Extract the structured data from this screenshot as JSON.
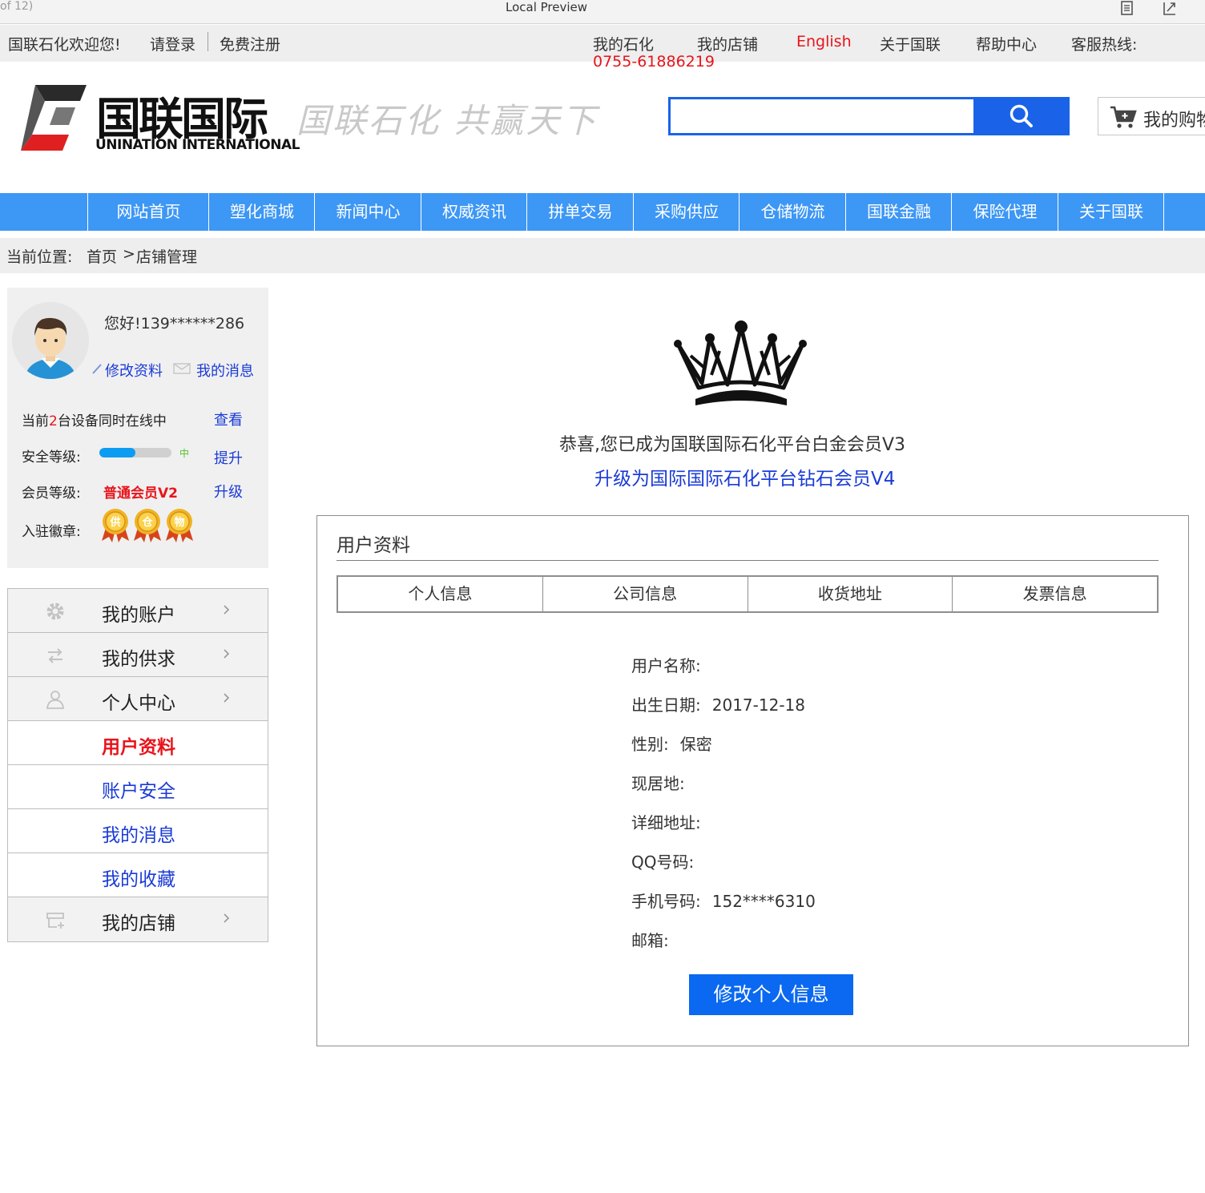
{
  "preview": {
    "page_info": "of 12)",
    "title": "Local Preview"
  },
  "topbar": {
    "welcome": "国联石化欢迎您!",
    "login": "请登录",
    "register": "免费注册",
    "my_petro": "我的石化",
    "my_shop": "我的店铺",
    "english": "English",
    "about": "关于国联",
    "help": "帮助中心",
    "hotline_label": "客服热线:",
    "hotline_number": "0755-61886219"
  },
  "header": {
    "logo_cn": "国联国际",
    "logo_en": "UNINATION INTERNATIONAL",
    "slogan": "国联石化 共赢天下",
    "search_value": "",
    "cart_label": "我的购物车"
  },
  "nav": [
    "网站首页",
    "塑化商城",
    "新闻中心",
    "权威资讯",
    "拼单交易",
    "采购供应",
    "仓储物流",
    "国联金融",
    "保险代理",
    "关于国联"
  ],
  "breadcrumb": {
    "label": "当前位置:",
    "home": "首页",
    "sep": ">",
    "current": "店铺管理"
  },
  "profile": {
    "greeting": "您好!139******286",
    "edit_profile": "修改资料",
    "my_messages": "我的消息",
    "devices_prefix": "当前",
    "devices_count": "2",
    "devices_suffix": "台设备同时在线中",
    "view": "查看",
    "security_label": "安全等级:",
    "security_level_text": "中",
    "security_level": 0.5,
    "improve": "提升",
    "member_label": "会员等级:",
    "member_level": "普通会员V2",
    "upgrade": "升级",
    "badges_label": "入驻徽章:",
    "badges": [
      "供",
      "仓",
      "物"
    ]
  },
  "menu": [
    {
      "label": "我的账户",
      "type": "group",
      "icon": "gear-icon"
    },
    {
      "label": "我的供求",
      "type": "group",
      "icon": "exchange-icon"
    },
    {
      "label": "个人中心",
      "type": "group",
      "icon": "user-icon"
    },
    {
      "label": "用户资料",
      "type": "active"
    },
    {
      "label": "账户安全",
      "type": "sub"
    },
    {
      "label": "我的消息",
      "type": "sub"
    },
    {
      "label": "我的收藏",
      "type": "sub"
    },
    {
      "label": "我的店铺",
      "type": "group",
      "icon": "shop-icon"
    }
  ],
  "main": {
    "congrats": "恭喜,您已成为国联国际石化平台白金会员V3",
    "upgrade_link": "升级为国际国际石化平台钻石会员V4",
    "panel_title": "用户资料",
    "tabs": [
      "个人信息",
      "公司信息",
      "收货地址",
      "发票信息"
    ],
    "fields": [
      {
        "label": "用户名称:",
        "value": ""
      },
      {
        "label": "出生日期:",
        "value": "2017-12-18"
      },
      {
        "label": "性别:",
        "value": "保密"
      },
      {
        "label": "现居地:",
        "value": ""
      },
      {
        "label": "详细地址:",
        "value": ""
      },
      {
        "label": "QQ号码:",
        "value": ""
      },
      {
        "label": "手机号码:",
        "value": "152****6310"
      },
      {
        "label": "邮箱:",
        "value": ""
      }
    ],
    "edit_button": "修改个人信息"
  },
  "colors": {
    "accent": "#1a63e8",
    "nav": "#3d97f5",
    "red": "#e8141b",
    "link": "#1a3bd6"
  }
}
